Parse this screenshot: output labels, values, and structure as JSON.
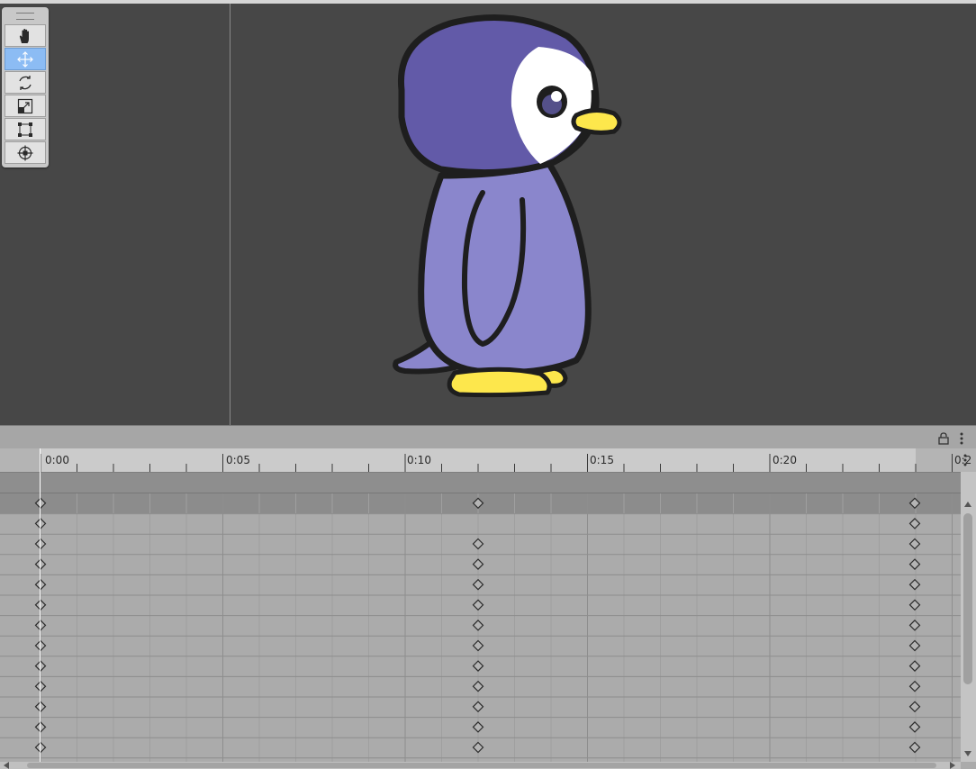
{
  "scene": {
    "tools": [
      {
        "name": "hand-tool-button",
        "icon": "hand-icon",
        "active": false
      },
      {
        "name": "move-tool-button",
        "icon": "move-arrows-icon",
        "active": true
      },
      {
        "name": "rotate-tool-button",
        "icon": "rotate-icon",
        "active": false
      },
      {
        "name": "scale-tool-button",
        "icon": "scale-icon",
        "active": false
      },
      {
        "name": "rect-tool-button",
        "icon": "rect-transform-icon",
        "active": false
      },
      {
        "name": "transform-tool-button",
        "icon": "transform-icon",
        "active": false
      }
    ]
  },
  "timeline": {
    "ruler_labels": [
      "0:00",
      "0:05",
      "0:10",
      "0:15",
      "0:20",
      "0:2"
    ],
    "row_count": 13,
    "keyframes": {
      "first_column_rows": [
        0,
        1,
        2,
        3,
        4,
        5,
        6,
        7,
        8,
        9,
        10,
        11,
        12
      ],
      "middle_column_rows": [
        0,
        2,
        3,
        4,
        5,
        6,
        7,
        8,
        9,
        10,
        11,
        12
      ],
      "last_column_rows": [
        0,
        1,
        2,
        3,
        4,
        5,
        6,
        7,
        8,
        9,
        10,
        11,
        12
      ]
    }
  },
  "colors": {
    "penguin_head": "#625aa8",
    "penguin_body": "#8a86cc",
    "penguin_beak": "#fde74c",
    "outline": "#1e1e1e",
    "active_tool": "#8cbcf4"
  }
}
